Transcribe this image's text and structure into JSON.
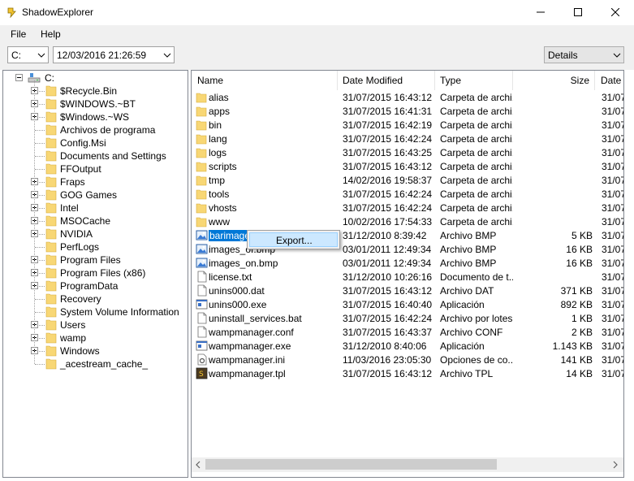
{
  "window": {
    "title": "ShadowExplorer"
  },
  "menu": {
    "file": "File",
    "help": "Help"
  },
  "toolbar": {
    "drive": "C:",
    "snapshot": "12/03/2016 21:26:59",
    "view": "Details"
  },
  "tree": {
    "root": "C:",
    "items": [
      {
        "label": "$Recycle.Bin",
        "expandable": true
      },
      {
        "label": "$WINDOWS.~BT",
        "expandable": true
      },
      {
        "label": "$Windows.~WS",
        "expandable": true
      },
      {
        "label": "Archivos de programa",
        "expandable": false
      },
      {
        "label": "Config.Msi",
        "expandable": false
      },
      {
        "label": "Documents and Settings",
        "expandable": false
      },
      {
        "label": "FFOutput",
        "expandable": false
      },
      {
        "label": "Fraps",
        "expandable": true
      },
      {
        "label": "GOG Games",
        "expandable": true
      },
      {
        "label": "Intel",
        "expandable": true
      },
      {
        "label": "MSOCache",
        "expandable": true
      },
      {
        "label": "NVIDIA",
        "expandable": true
      },
      {
        "label": "PerfLogs",
        "expandable": false
      },
      {
        "label": "Program Files",
        "expandable": true
      },
      {
        "label": "Program Files (x86)",
        "expandable": true
      },
      {
        "label": "ProgramData",
        "expandable": true
      },
      {
        "label": "Recovery",
        "expandable": false
      },
      {
        "label": "System Volume Information",
        "expandable": false
      },
      {
        "label": "Users",
        "expandable": true
      },
      {
        "label": "wamp",
        "expandable": true
      },
      {
        "label": "Windows",
        "expandable": true
      },
      {
        "label": "_acestream_cache_",
        "expandable": false
      }
    ]
  },
  "list": {
    "columns": {
      "name": "Name",
      "date": "Date Modified",
      "type": "Type",
      "size": "Size",
      "date2": "Date"
    },
    "rows": [
      {
        "icon": "folder-icon",
        "name": "alias",
        "date": "31/07/2015 16:43:12",
        "type": "Carpeta de archi...",
        "size": "",
        "date2": "31/07"
      },
      {
        "icon": "folder-icon",
        "name": "apps",
        "date": "31/07/2015 16:41:31",
        "type": "Carpeta de archi...",
        "size": "",
        "date2": "31/07"
      },
      {
        "icon": "folder-icon",
        "name": "bin",
        "date": "31/07/2015 16:42:19",
        "type": "Carpeta de archi...",
        "size": "",
        "date2": "31/07"
      },
      {
        "icon": "folder-icon",
        "name": "lang",
        "date": "31/07/2015 16:42:24",
        "type": "Carpeta de archi...",
        "size": "",
        "date2": "31/07"
      },
      {
        "icon": "folder-icon",
        "name": "logs",
        "date": "31/07/2015 16:43:25",
        "type": "Carpeta de archi...",
        "size": "",
        "date2": "31/07"
      },
      {
        "icon": "folder-icon",
        "name": "scripts",
        "date": "31/07/2015 16:43:12",
        "type": "Carpeta de archi...",
        "size": "",
        "date2": "31/07"
      },
      {
        "icon": "folder-icon",
        "name": "tmp",
        "date": "14/02/2016 19:58:37",
        "type": "Carpeta de archi...",
        "size": "",
        "date2": "31/07"
      },
      {
        "icon": "folder-icon",
        "name": "tools",
        "date": "31/07/2015 16:42:24",
        "type": "Carpeta de archi...",
        "size": "",
        "date2": "31/07"
      },
      {
        "icon": "folder-icon",
        "name": "vhosts",
        "date": "31/07/2015 16:42:24",
        "type": "Carpeta de archi...",
        "size": "",
        "date2": "31/07"
      },
      {
        "icon": "folder-icon",
        "name": "www",
        "date": "10/02/2016 17:54:33",
        "type": "Carpeta de archi...",
        "size": "",
        "date2": "31/07"
      },
      {
        "icon": "bitmap-icon",
        "name": "barimage.",
        "date": "31/12/2010 8:39:42",
        "type": "Archivo BMP",
        "size": "5 KB",
        "date2": "31/07",
        "selected": true
      },
      {
        "icon": "bitmap-icon",
        "name": "images_of.bmp",
        "date": "03/01/2011 12:49:34",
        "type": "Archivo BMP",
        "size": "16 KB",
        "date2": "31/07"
      },
      {
        "icon": "bitmap-icon",
        "name": "images_on.bmp",
        "date": "03/01/2011 12:49:34",
        "type": "Archivo BMP",
        "size": "16 KB",
        "date2": "31/07"
      },
      {
        "icon": "document-icon",
        "name": "license.txt",
        "date": "31/12/2010 10:26:16",
        "type": "Documento de t...",
        "size": "",
        "date2": "31/07"
      },
      {
        "icon": "document-icon",
        "name": "unins000.dat",
        "date": "31/07/2015 16:43:12",
        "type": "Archivo DAT",
        "size": "371 KB",
        "date2": "31/07"
      },
      {
        "icon": "application-icon",
        "name": "unins000.exe",
        "date": "31/07/2015 16:40:40",
        "type": "Aplicación",
        "size": "892 KB",
        "date2": "31/07"
      },
      {
        "icon": "document-icon",
        "name": "uninstall_services.bat",
        "date": "31/07/2015 16:42:24",
        "type": "Archivo por lotes...",
        "size": "1 KB",
        "date2": "31/07"
      },
      {
        "icon": "document-icon",
        "name": "wampmanager.conf",
        "date": "31/07/2015 16:43:37",
        "type": "Archivo CONF",
        "size": "2 KB",
        "date2": "31/07"
      },
      {
        "icon": "application-icon",
        "name": "wampmanager.exe",
        "date": "31/12/2010 8:40:06",
        "type": "Aplicación",
        "size": "1.143 KB",
        "date2": "31/07"
      },
      {
        "icon": "settings-file-icon",
        "name": "wampmanager.ini",
        "date": "11/03/2016 23:05:30",
        "type": "Opciones de co...",
        "size": "141 KB",
        "date2": "31/07"
      },
      {
        "icon": "template-file-icon",
        "name": "wampmanager.tpl",
        "date": "31/07/2015 16:43:12",
        "type": "Archivo TPL",
        "size": "14 KB",
        "date2": "31/07"
      }
    ]
  },
  "context_menu": {
    "export": "Export..."
  },
  "colors": {
    "folder": "#f8d775",
    "selection": "#0078d7",
    "menu_highlight": "#cce8ff"
  }
}
